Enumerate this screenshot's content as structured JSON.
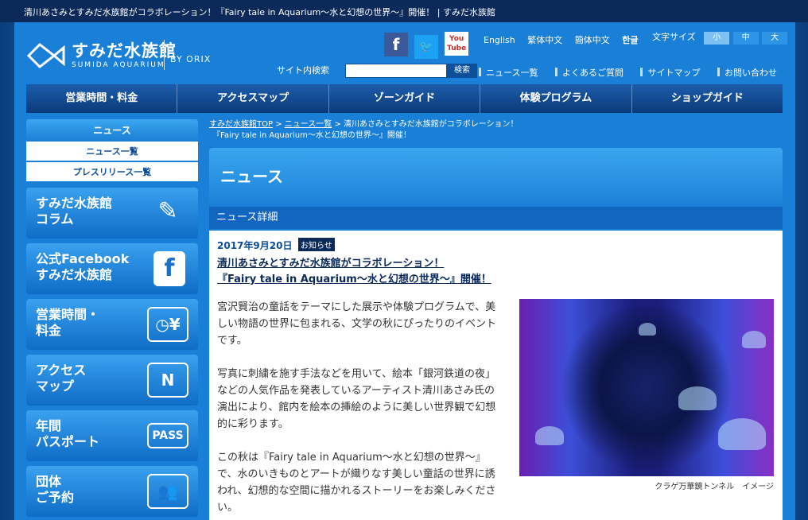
{
  "top_bar": {
    "title": "清川あさみとすみだ水族館がコラボレーション！『Fairy tale in Aquarium〜水と幻想の世界〜』開催！ | すみだ水族館"
  },
  "logo": {
    "ja": "すみだ水族館",
    "en": "SUMIDA AQUARIUM",
    "partner": "BY ORIX"
  },
  "social": {
    "facebook": "f",
    "twitter": "t",
    "youtube": "You Tube"
  },
  "languages": [
    "English",
    "繁体中文",
    "簡体中文",
    "한글"
  ],
  "font_size": {
    "label": "文字サイズ",
    "options": [
      "小",
      "中",
      "大"
    ]
  },
  "search": {
    "label": "サイト内検索",
    "placeholder": "",
    "button": "検索"
  },
  "top_links": [
    "ニュース一覧",
    "よくあるご質問",
    "サイトマップ",
    "お問い合わせ"
  ],
  "global_nav": [
    "営業時間・料金",
    "アクセスマップ",
    "ゾーンガイド",
    "体験プログラム",
    "ショップガイド"
  ],
  "sidebar": {
    "news_heading": "ニュース",
    "sub_items": [
      "ニュース一覧",
      "プレスリリース一覧"
    ],
    "banners": [
      {
        "line1": "すみだ水族館",
        "line2": "コラム",
        "icon": "pen-tablet-icon",
        "glyph": "✎"
      },
      {
        "line1": "公式Facebook",
        "line2": "すみだ水族館",
        "icon": "facebook-icon",
        "glyph": "f"
      },
      {
        "line1": "営業時間・",
        "line2": "料金",
        "icon": "clock-yen-icon",
        "glyph": "◷¥"
      },
      {
        "line1": "アクセス",
        "line2": "マップ",
        "icon": "compass-icon",
        "glyph": "N"
      },
      {
        "line1": "年間",
        "line2": "パスポート",
        "icon": "pass-icon",
        "glyph": "PASS"
      },
      {
        "line1": "団体",
        "line2": "ご予約",
        "icon": "group-icon",
        "glyph": "👥"
      }
    ]
  },
  "breadcrumb": {
    "home": "すみだ水族館TOP",
    "sep": " > ",
    "news": "ニュース一覧",
    "current_line1": "清川あさみとすみだ水族館がコラボレーション！",
    "current_line2": "『Fairy tale in Aquarium〜水と幻想の世界〜』開催！"
  },
  "main": {
    "heading": "ニュース",
    "detail_heading": "ニュース詳細",
    "date": "2017年9月20日",
    "badge": "お知らせ",
    "title_line1": "清川あさみとすみだ水族館がコラボレーション！",
    "title_line2": "『Fairy tale in Aquarium〜水と幻想の世界〜』開催！",
    "paragraphs": [
      "宮沢賢治の童話をテーマにした展示や体験プログラムで、美しい物語の世界に包まれる、文学の秋にぴったりのイベントです。",
      "写真に刺繍を施す手法などを用いて、絵本「銀河鉄道の夜」などの人気作品を発表しているアーティスト清川あさみ氏の演出により、館内を絵本の挿絵のように美しい世界観で幻想的に彩ります。",
      "この秋は『Fairy tale in Aquarium〜水と幻想の世界〜』で、水のいきものとアートが織りなす美しい童話の世界に誘われ、幻想的な空間に描かれるストーリーをお楽しみください。"
    ],
    "photo_caption": "クラゲ万華鏡トンネル　イメージ"
  }
}
